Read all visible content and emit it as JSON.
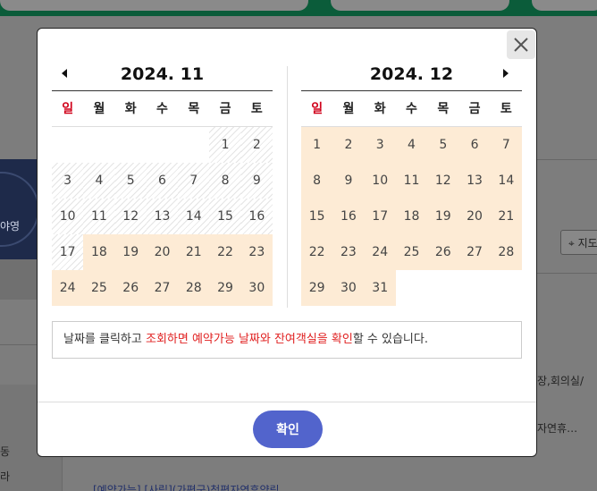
{
  "background": {
    "logo_text": "야영",
    "location_label": "지도",
    "side_text_1": "장,회의실/",
    "side_text_2": "자연휴…",
    "left_text_1": "동",
    "left_text_2": "라",
    "bottom_text": "[예약가능] [사립](가평군)청평자연휴양림"
  },
  "modal": {
    "left_calendar": {
      "title": "2024. 11",
      "weekdays": [
        "일",
        "월",
        "화",
        "수",
        "목",
        "금",
        "토"
      ],
      "days": [
        {
          "d": "",
          "s": "empty"
        },
        {
          "d": "",
          "s": "empty"
        },
        {
          "d": "",
          "s": "empty"
        },
        {
          "d": "",
          "s": "empty"
        },
        {
          "d": "",
          "s": "empty"
        },
        {
          "d": "1",
          "s": "past"
        },
        {
          "d": "2",
          "s": "past"
        },
        {
          "d": "3",
          "s": "past"
        },
        {
          "d": "4",
          "s": "past"
        },
        {
          "d": "5",
          "s": "past"
        },
        {
          "d": "6",
          "s": "past"
        },
        {
          "d": "7",
          "s": "past"
        },
        {
          "d": "8",
          "s": "past"
        },
        {
          "d": "9",
          "s": "past"
        },
        {
          "d": "10",
          "s": "past"
        },
        {
          "d": "11",
          "s": "past"
        },
        {
          "d": "12",
          "s": "past"
        },
        {
          "d": "13",
          "s": "past"
        },
        {
          "d": "14",
          "s": "past"
        },
        {
          "d": "15",
          "s": "past"
        },
        {
          "d": "16",
          "s": "past"
        },
        {
          "d": "17",
          "s": "past"
        },
        {
          "d": "18",
          "s": "avail"
        },
        {
          "d": "19",
          "s": "avail"
        },
        {
          "d": "20",
          "s": "avail"
        },
        {
          "d": "21",
          "s": "avail"
        },
        {
          "d": "22",
          "s": "avail"
        },
        {
          "d": "23",
          "s": "avail"
        },
        {
          "d": "24",
          "s": "avail"
        },
        {
          "d": "25",
          "s": "avail"
        },
        {
          "d": "26",
          "s": "avail"
        },
        {
          "d": "27",
          "s": "avail"
        },
        {
          "d": "28",
          "s": "avail"
        },
        {
          "d": "29",
          "s": "avail"
        },
        {
          "d": "30",
          "s": "avail"
        }
      ]
    },
    "right_calendar": {
      "title": "2024. 12",
      "weekdays": [
        "일",
        "월",
        "화",
        "수",
        "목",
        "금",
        "토"
      ],
      "days": [
        {
          "d": "1",
          "s": "avail"
        },
        {
          "d": "2",
          "s": "avail"
        },
        {
          "d": "3",
          "s": "avail"
        },
        {
          "d": "4",
          "s": "avail"
        },
        {
          "d": "5",
          "s": "avail"
        },
        {
          "d": "6",
          "s": "avail"
        },
        {
          "d": "7",
          "s": "avail"
        },
        {
          "d": "8",
          "s": "avail"
        },
        {
          "d": "9",
          "s": "avail"
        },
        {
          "d": "10",
          "s": "avail"
        },
        {
          "d": "11",
          "s": "avail"
        },
        {
          "d": "12",
          "s": "avail"
        },
        {
          "d": "13",
          "s": "avail"
        },
        {
          "d": "14",
          "s": "avail"
        },
        {
          "d": "15",
          "s": "avail"
        },
        {
          "d": "16",
          "s": "avail"
        },
        {
          "d": "17",
          "s": "avail"
        },
        {
          "d": "18",
          "s": "avail"
        },
        {
          "d": "19",
          "s": "avail"
        },
        {
          "d": "20",
          "s": "avail"
        },
        {
          "d": "21",
          "s": "avail"
        },
        {
          "d": "22",
          "s": "avail"
        },
        {
          "d": "23",
          "s": "avail"
        },
        {
          "d": "24",
          "s": "avail"
        },
        {
          "d": "25",
          "s": "avail"
        },
        {
          "d": "26",
          "s": "avail"
        },
        {
          "d": "27",
          "s": "avail"
        },
        {
          "d": "28",
          "s": "avail"
        },
        {
          "d": "29",
          "s": "avail"
        },
        {
          "d": "30",
          "s": "avail"
        },
        {
          "d": "31",
          "s": "avail"
        }
      ]
    },
    "notice": {
      "part1": "날짜를 클릭하고 ",
      "part2": "조회하면 예약가능 날짜와 잔여객실을 확인",
      "part3": "할 수 있습니다."
    },
    "confirm_label": "확인",
    "close_icon": "close-icon",
    "prev_icon": "caret-left-icon",
    "next_icon": "caret-right-icon"
  },
  "colors": {
    "available_bg": "#fdebd5",
    "sunday": "#d0021b",
    "confirm_button": "#5264cc",
    "notice_highlight": "#e02020"
  }
}
